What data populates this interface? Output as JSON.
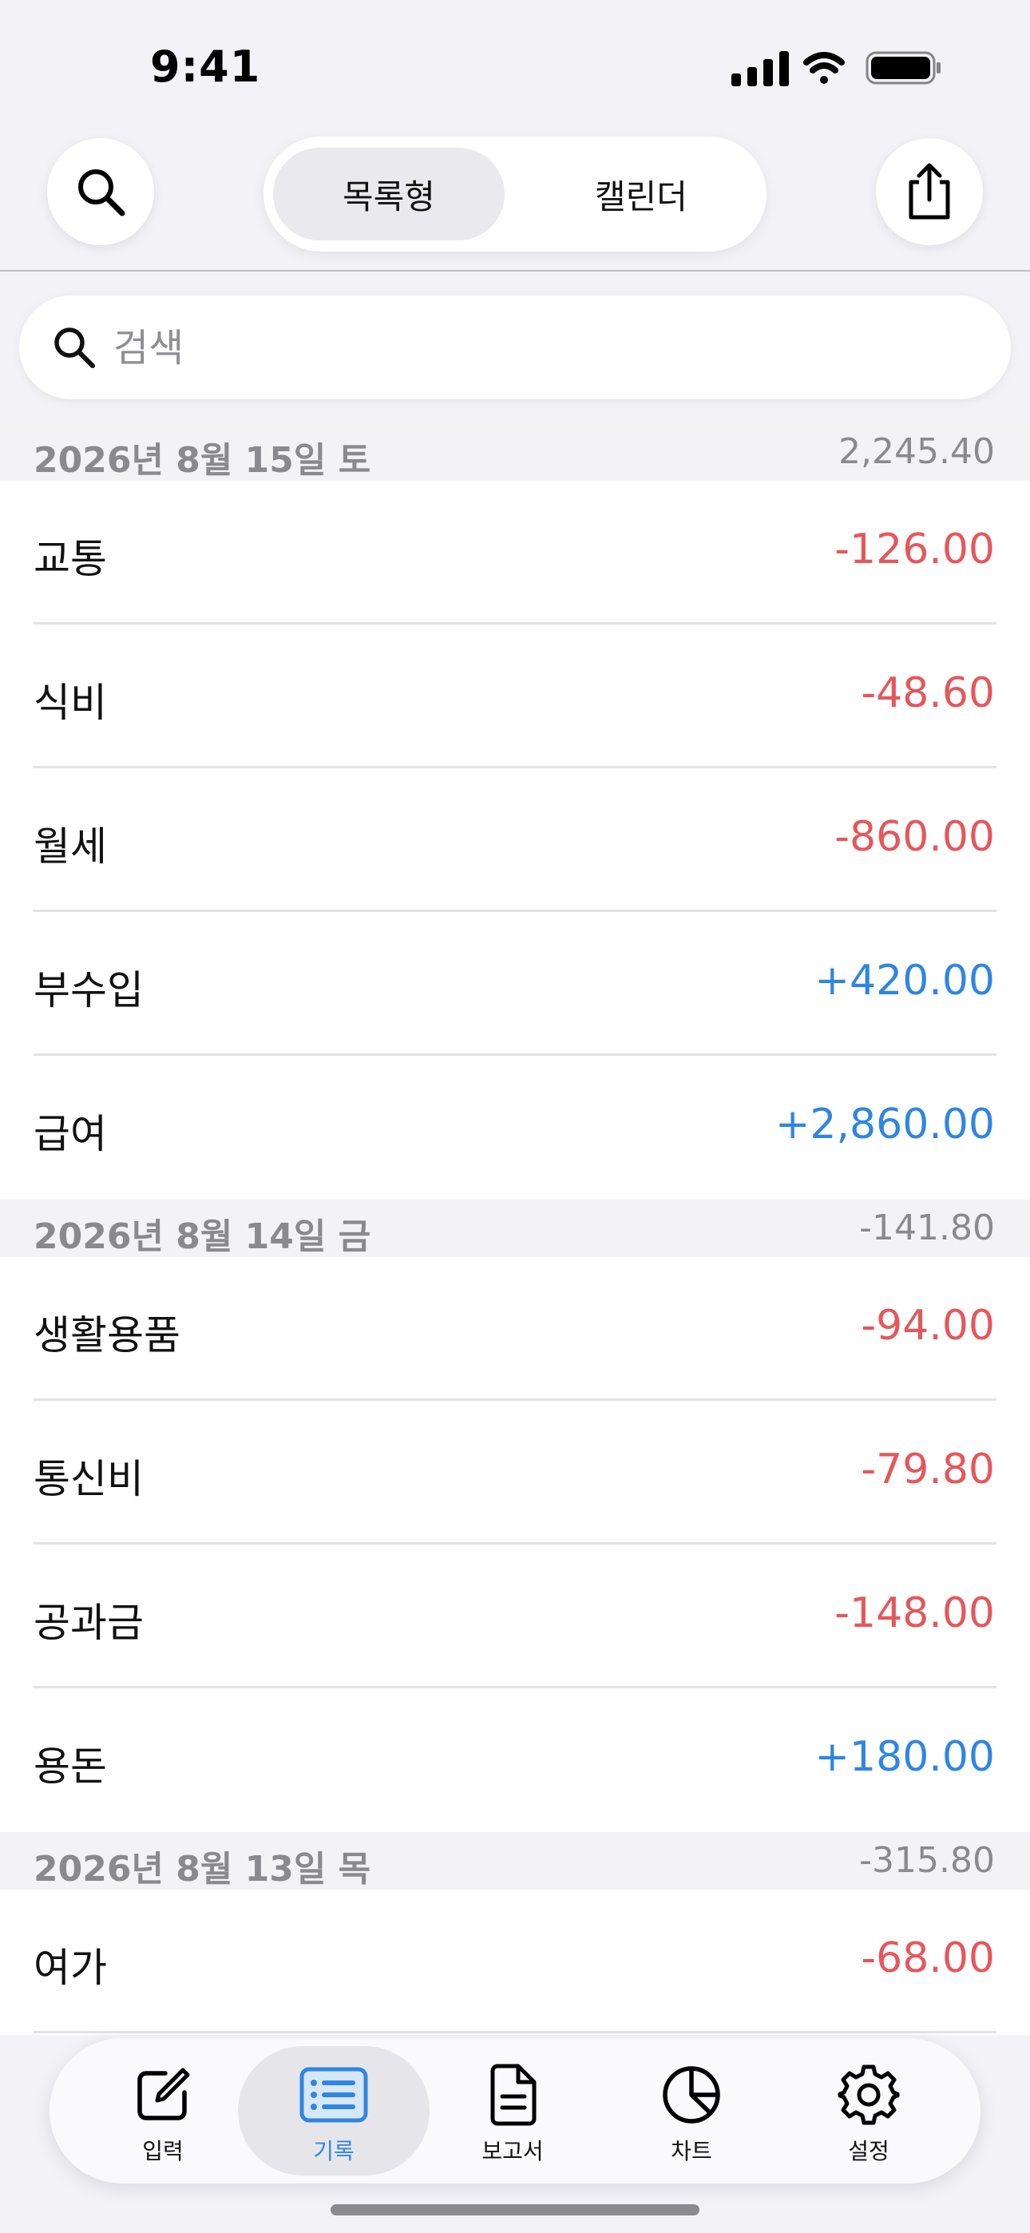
{
  "status_bar": {
    "time": "9:41"
  },
  "toolbar": {
    "segments": [
      {
        "label": "목록형",
        "active": true
      },
      {
        "label": "캘린더",
        "active": false
      }
    ]
  },
  "search": {
    "placeholder": "검색"
  },
  "days": [
    {
      "date": "2026년 8월 15일 토",
      "total": "2,245.40",
      "rows": [
        {
          "category": "교통",
          "amount": "-126.00",
          "sign": "neg"
        },
        {
          "category": "식비",
          "amount": "-48.60",
          "sign": "neg"
        },
        {
          "category": "월세",
          "amount": "-860.00",
          "sign": "neg"
        },
        {
          "category": "부수입",
          "amount": "+420.00",
          "sign": "pos"
        },
        {
          "category": "급여",
          "amount": "+2,860.00",
          "sign": "pos"
        }
      ]
    },
    {
      "date": "2026년 8월 14일 금",
      "total": "-141.80",
      "rows": [
        {
          "category": "생활용품",
          "amount": "-94.00",
          "sign": "neg"
        },
        {
          "category": "통신비",
          "amount": "-79.80",
          "sign": "neg"
        },
        {
          "category": "공과금",
          "amount": "-148.00",
          "sign": "neg"
        },
        {
          "category": "용돈",
          "amount": "+180.00",
          "sign": "pos"
        }
      ]
    },
    {
      "date": "2026년 8월 13일 목",
      "total": "-315.80",
      "rows": [
        {
          "category": "여가",
          "amount": "-68.00",
          "sign": "neg"
        }
      ]
    }
  ],
  "colors": {
    "negative": "#e5575b",
    "positive": "#2f86e0",
    "accent": "#2f86e0"
  },
  "tabs": [
    {
      "label": "입력",
      "icon": "compose-icon",
      "active": false
    },
    {
      "label": "기록",
      "icon": "list-icon",
      "active": true
    },
    {
      "label": "보고서",
      "icon": "document-icon",
      "active": false
    },
    {
      "label": "차트",
      "icon": "pie-chart-icon",
      "active": false
    },
    {
      "label": "설정",
      "icon": "gear-icon",
      "active": false
    }
  ]
}
